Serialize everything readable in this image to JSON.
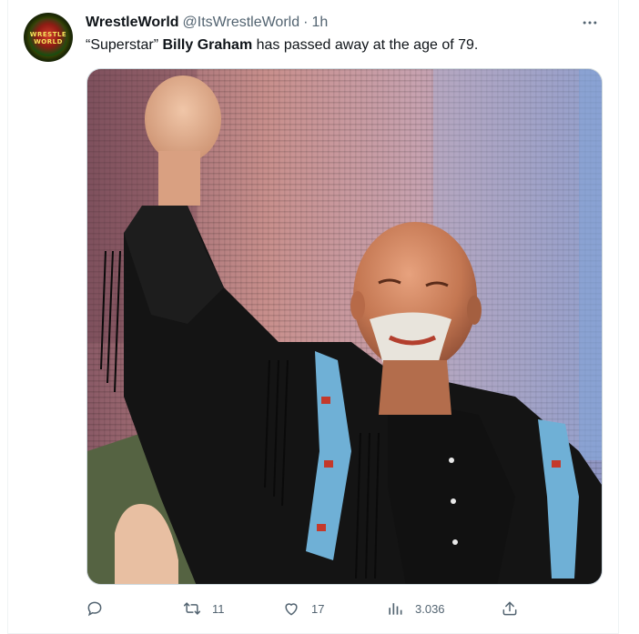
{
  "tweet": {
    "display_name": "WrestleWorld",
    "handle": "@ItsWrestleWorld",
    "separator": "·",
    "time": "1h",
    "avatar_icon": "wrestleworld-logo",
    "text": {
      "part1": "“Superstar” ",
      "bold": "Billy Graham",
      "part2": " has passed away at the age of 79."
    },
    "more_icon": "more-horizontal-icon",
    "media": {
      "description_icon": "photo"
    }
  },
  "actions": {
    "reply": {
      "icon": "reply-icon",
      "count": ""
    },
    "retweet": {
      "icon": "retweet-icon",
      "count": "11"
    },
    "like": {
      "icon": "heart-icon",
      "count": "17"
    },
    "views": {
      "icon": "views-icon",
      "count": "3.036"
    },
    "share": {
      "icon": "share-icon",
      "count": ""
    }
  },
  "colors": {
    "primary_text": "#0f1419",
    "secondary_text": "#536471",
    "border": "#cfd9de"
  }
}
